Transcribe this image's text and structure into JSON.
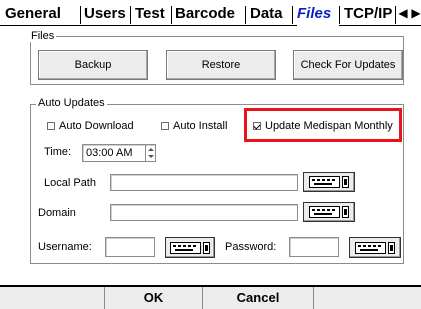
{
  "tabs": [
    {
      "label": "General",
      "active": false
    },
    {
      "label": "Users",
      "active": false
    },
    {
      "label": "Test",
      "active": false
    },
    {
      "label": "Barcode",
      "active": false
    },
    {
      "label": "Data",
      "active": false
    },
    {
      "label": "Files",
      "active": true
    },
    {
      "label": "TCP/IP",
      "active": false
    }
  ],
  "tab_scroll": {
    "left_icon": "scroll-left-icon",
    "right_icon": "scroll-right-icon",
    "left_glyph": "◀",
    "right_glyph": "▶"
  },
  "files_group": {
    "legend": "Files",
    "backup_label": "Backup",
    "restore_label": "Restore",
    "check_updates_label": "Check For Updates"
  },
  "auto_updates": {
    "legend": "Auto Updates",
    "auto_download": {
      "label": "Auto Download",
      "checked": false
    },
    "auto_install": {
      "label": "Auto Install",
      "checked": false
    },
    "update_medispan": {
      "label": "Update Medispan Monthly",
      "checked": true
    },
    "time_label": "Time:",
    "time_value": "03:00 AM",
    "local_path_label": "Local Path",
    "local_path_value": "",
    "domain_label": "Domain",
    "domain_value": "",
    "username_label": "Username:",
    "username_value": "",
    "password_label": "Password:",
    "password_value": ""
  },
  "footer": {
    "ok_label": "OK",
    "cancel_label": "Cancel"
  },
  "colors": {
    "active_tab": "#0b1fc8",
    "highlight": "#e8141c"
  }
}
